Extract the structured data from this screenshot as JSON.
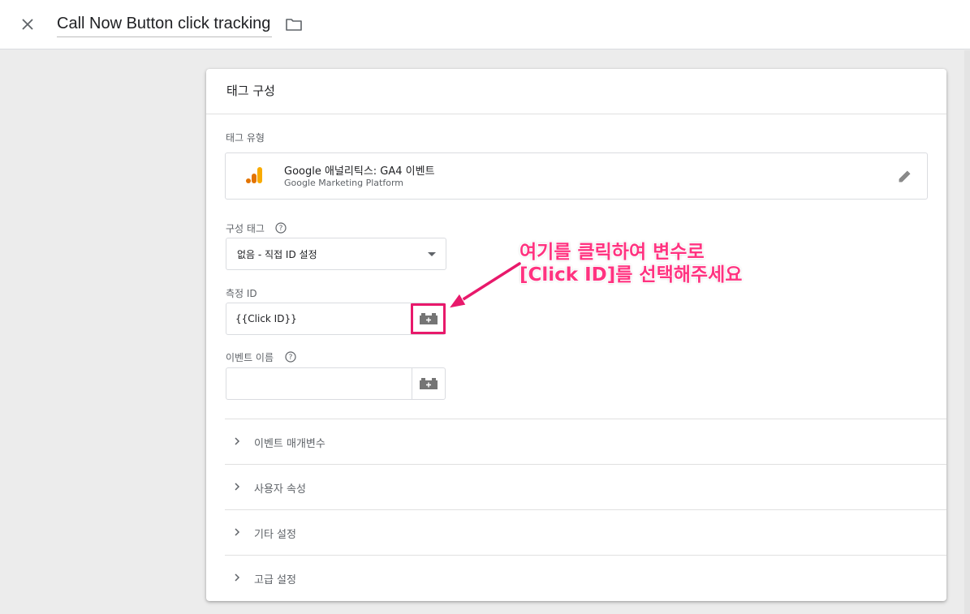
{
  "header": {
    "title": "Call Now Button click tracking"
  },
  "card": {
    "title": "태그 구성",
    "tag_type": {
      "label": "태그 유형",
      "name": "Google 애널리틱스: GA4 이벤트",
      "platform": "Google Marketing Platform"
    },
    "config_tag": {
      "label": "구성 태그",
      "selected": "없음 - 직접 ID 설정"
    },
    "measurement_id": {
      "label": "측정 ID",
      "value": "{{Click ID}}"
    },
    "event_name": {
      "label": "이벤트 이름",
      "value": ""
    },
    "sections": [
      {
        "label": "이벤트 매개변수"
      },
      {
        "label": "사용자 속성"
      },
      {
        "label": "기타 설정"
      },
      {
        "label": "고급 설정"
      }
    ]
  },
  "annotation": {
    "line1": "여기를 클릭하여 변수로",
    "line2": "[Click ID]를 선택해주세요",
    "color": "#ff3380"
  },
  "colors": {
    "ga_orange": "#f9ab00",
    "ga_dark": "#e37400",
    "highlight": "#e8196b"
  }
}
